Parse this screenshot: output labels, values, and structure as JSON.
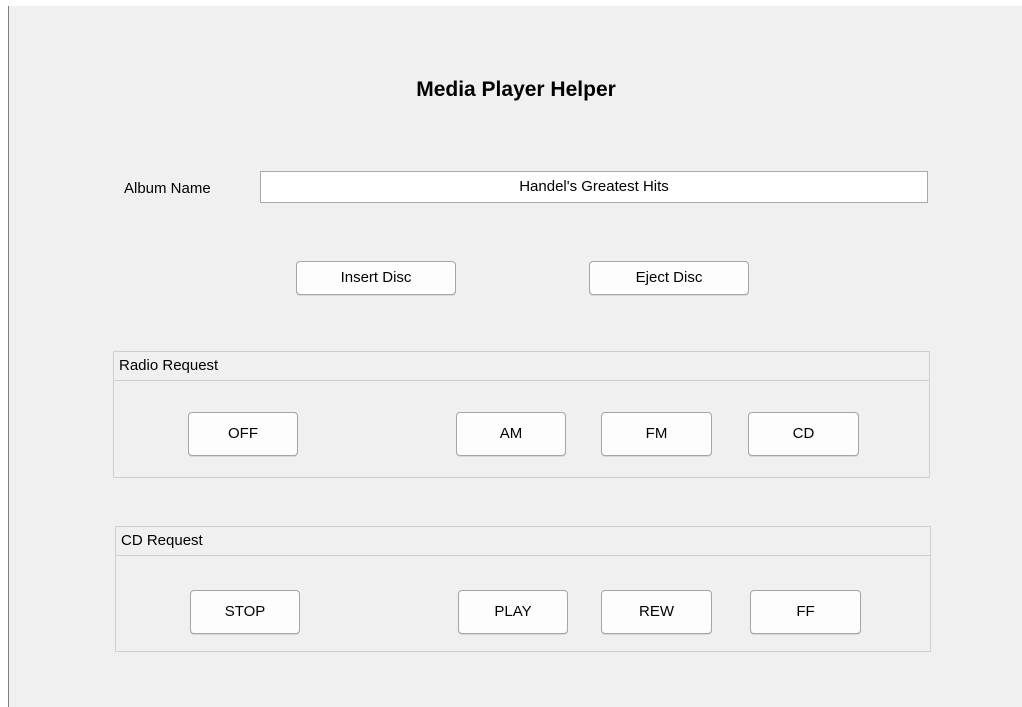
{
  "title": "Media Player Helper",
  "album": {
    "label": "Album Name",
    "value": "Handel's Greatest Hits"
  },
  "disc_buttons": {
    "insert": "Insert Disc",
    "eject": "Eject Disc"
  },
  "radio_panel": {
    "title": "Radio Request",
    "buttons": [
      "OFF",
      "AM",
      "FM",
      "CD"
    ]
  },
  "cd_panel": {
    "title": "CD Request",
    "buttons": [
      "STOP",
      "PLAY",
      "REW",
      "FF"
    ]
  }
}
